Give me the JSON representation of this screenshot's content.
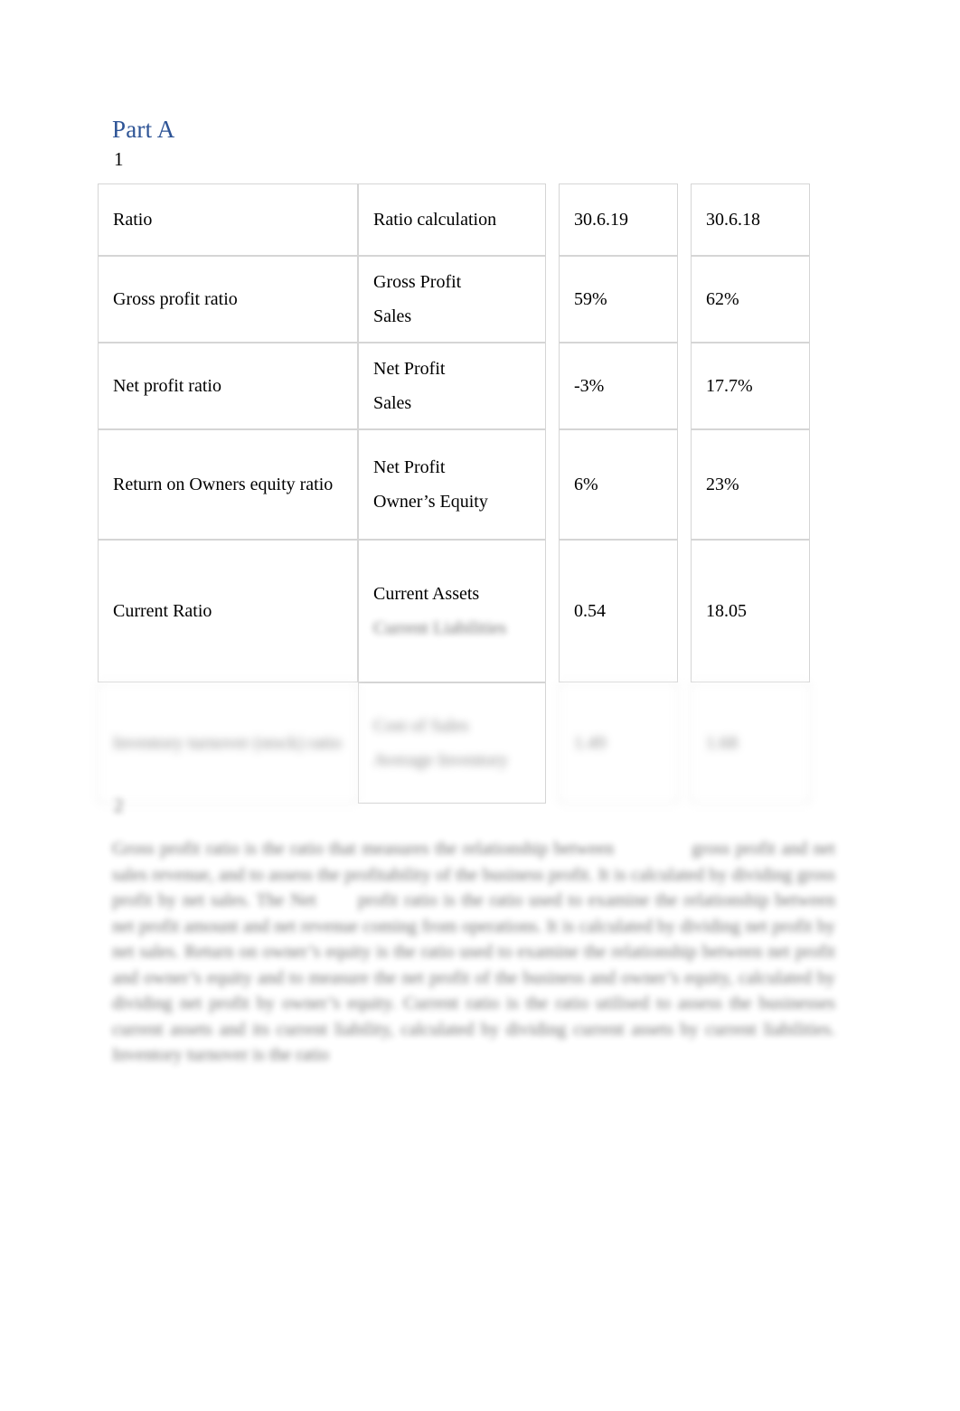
{
  "document": {
    "heading": "Part A",
    "question_number_1": "1",
    "question_number_2": "2"
  },
  "table": {
    "headers": {
      "ratio": "Ratio",
      "calculation": "Ratio calculation",
      "period_current": "30.6.19",
      "period_prior": "30.6.18"
    },
    "rows": [
      {
        "name": "Gross profit ratio",
        "numerator": "Gross Profit",
        "denominator": "Sales",
        "value_current": "59%",
        "value_prior": "62%",
        "blurred": false
      },
      {
        "name": "Net profit ratio",
        "numerator": "Net Profit",
        "denominator": "Sales",
        "value_current": "-3%",
        "value_prior": "17.7%",
        "blurred": false
      },
      {
        "name": "Return on Owners equity ratio",
        "numerator": "Net Profit",
        "denominator": "Owner’s Equity",
        "value_current": "6%",
        "value_prior": "23%",
        "blurred": false
      },
      {
        "name": "Current Ratio",
        "numerator": "Current Assets",
        "denominator": "Current Liabilities",
        "value_current": "0.54",
        "value_prior": "18.05",
        "blurred": false,
        "denominator_blurred": true
      },
      {
        "name": "Inventory turnover (stock) ratio",
        "numerator": "Cost of Sales",
        "denominator": "Average Inventory",
        "value_current": "1.49",
        "value_prior": "1.68",
        "blurred": true
      }
    ]
  },
  "paragraph": {
    "lines": [
      "Gross profit ratio is the ratio that measures the relationship between",
      "gross profit and net sales revenue, and to assess the profitability of the",
      "business profit. It is calculated by dividing gross profit by net sales. The Net",
      "profit ratio is the ratio used to examine the relationship between net",
      "profit amount and net revenue coming from operations. It is calculated by",
      "dividing net profit by net sales. Return on owner’s equity is the ratio used",
      "to examine the relationship between net profit and owner’s equity and to",
      "measure the net profit of the business and owner’s equity, calculated by",
      "dividing net profit by owner’s equity. Current ratio is the ratio utilised to",
      "assess the businesses current assets and its current liability, calculated by",
      "dividing current assets by current liabilities. Inventory turnover is the ratio"
    ]
  },
  "colors": {
    "heading_blue": "#2e5496",
    "text_black": "#000000",
    "table_border": "#d5d5d5",
    "page_background": "#ffffff"
  }
}
